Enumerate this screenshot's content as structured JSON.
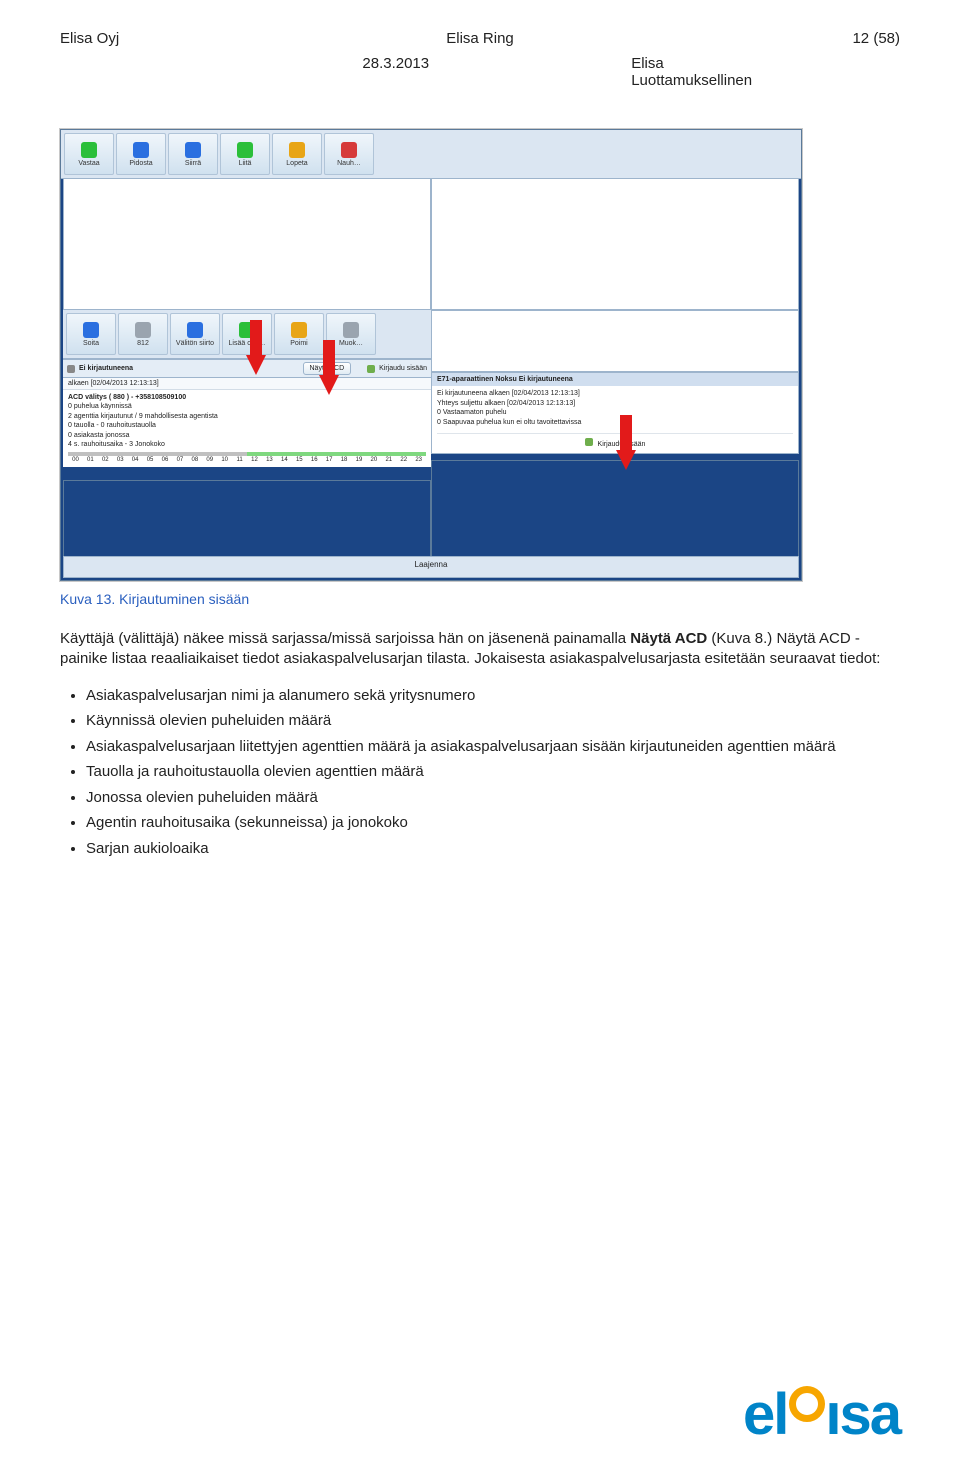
{
  "header": {
    "company": "Elisa Oyj",
    "product": "Elisa Ring",
    "page": "12 (58)",
    "date": "28.3.2013",
    "brand": "Elisa",
    "confidential": "Luottamuksellinen"
  },
  "screenshot": {
    "toolbar1": [
      {
        "label": "Vastaa",
        "color": "#2bbf3a"
      },
      {
        "label": "Pidosta",
        "color": "#2a6fe0"
      },
      {
        "label": "Siirrä",
        "color": "#2a6fe0"
      },
      {
        "label": "Liitä",
        "color": "#2bbf3a"
      },
      {
        "label": "Lopeta",
        "color": "#e8a516"
      },
      {
        "label": "Nauh…",
        "color": "#d63a3a"
      }
    ],
    "toolbar2": [
      {
        "label": "Soita",
        "color": "#2a6fe0"
      },
      {
        "label": "812",
        "color": "#9aa4af"
      },
      {
        "label": "Välitön siirto",
        "color": "#2a6fe0"
      },
      {
        "label": "Lisää osa…",
        "color": "#2bbf3a"
      },
      {
        "label": "Poimi",
        "color": "#e8a516"
      },
      {
        "label": "Muok…",
        "color": "#9aa4af"
      }
    ],
    "status_left": {
      "state_label": "Ei kirjautuneena",
      "since": "alkaen [02/04/2013 12:13:13]",
      "nayta_acd": "Näytä ACD",
      "kirjaudu": "Kirjaudu sisään"
    },
    "acd": {
      "title": "ACD välitys ( 880 ) - +358108509100",
      "lines": [
        "0 puhelua käynnissä",
        "2 agenttia kirjautunut / 9 mahdollisesta agentista",
        "0 tauolla - 0 rauhoitustauolla",
        "0 asiakasta jonossa",
        "4 s. rauhoitusaika - 3 Jonokoko"
      ],
      "hours": [
        "00",
        "01",
        "02",
        "03",
        "04",
        "05",
        "06",
        "07",
        "08",
        "09",
        "10",
        "11",
        "12",
        "13",
        "14",
        "15",
        "16",
        "17",
        "18",
        "19",
        "20",
        "21",
        "22",
        "23"
      ]
    },
    "e71": {
      "title": "E71-aparaattinen Noksu Ei kirjautuneena",
      "lines": [
        "Ei kirjautuneena alkaen [02/04/2013 12:13:13]",
        "Yhteys suljettu alkaen [02/04/2013 12:13:13]",
        "0 Vastaamaton puhelu",
        "0 Saapuvaa puhelua kun ei oltu tavoitettavissa"
      ],
      "login": "Kirjaudu sisään"
    },
    "bottom": "Laajenna"
  },
  "caption": "Kuva 13. Kirjautuminen sisään",
  "para": {
    "p1a": "Käyttäjä (välittäjä) näkee missä sarjassa/missä sarjoissa hän on jäsenenä painamalla ",
    "p1b": "Näytä ACD",
    "p1c": " (Kuva 8.) Näytä ACD -painike listaa reaaliaikaiset tiedot asiakaspalvelusarjan tilasta. Jokaisesta asiakaspalvelusarjasta esitetään seuraavat tiedot:"
  },
  "bullets": [
    "Asiakaspalvelusarjan nimi ja alanumero sekä yritysnumero",
    "Käynnissä olevien puheluiden määrä",
    "Asiakaspalvelusarjaan liitettyjen agenttien määrä ja asiakaspalvelusarjaan sisään kirjautuneiden agenttien määrä",
    "Tauolla ja rauhoitustauolla olevien agenttien määrä",
    "Jonossa olevien puheluiden määrä",
    "Agentin rauhoitusaika (sekunneissa) ja jonokoko",
    "Sarjan aukioloaika"
  ],
  "logo": "elisa"
}
